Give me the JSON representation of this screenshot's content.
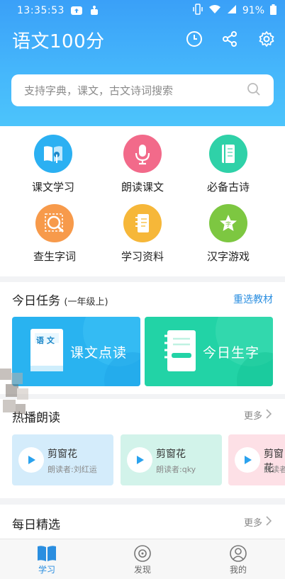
{
  "status_bar": {
    "time": "13:35:53",
    "battery": "91%"
  },
  "header": {
    "title": "语文100分",
    "icons": [
      "history-clock-icon",
      "share-icon",
      "settings-gear-icon"
    ]
  },
  "search": {
    "placeholder": "支持字典，课文，古文诗词搜索"
  },
  "grid": {
    "items": [
      {
        "label": "课文学习",
        "color": "#2bb0f2"
      },
      {
        "label": "朗读课文",
        "color": "#f26a8a"
      },
      {
        "label": "必备古诗",
        "color": "#2fd1a8"
      },
      {
        "label": "查生字词",
        "color": "#f79a4b"
      },
      {
        "label": "学习资料",
        "color": "#f6b739"
      },
      {
        "label": "汉字游戏",
        "color": "#7dc741"
      }
    ]
  },
  "today_task": {
    "title": "今日任务",
    "grade": "(一年级上)",
    "reselect": "重选教材",
    "cards": [
      {
        "label": "课文点读",
        "book_label": "语 文",
        "color": "#29b3f0"
      },
      {
        "label": "今日生字",
        "color": "#22d3a6"
      }
    ]
  },
  "hot_reading": {
    "title": "热播朗读",
    "more": "更多",
    "items": [
      {
        "title": "剪窗花",
        "reader": "朗读者:刘红运",
        "bg": "#d4ecfb"
      },
      {
        "title": "剪窗花",
        "reader": "朗读者:qky",
        "bg": "#d2f3ea"
      },
      {
        "title": "剪窗花",
        "reader": "朗读者",
        "bg": "#fde0e6"
      }
    ]
  },
  "daily_pick": {
    "title": "每日精选",
    "more": "更多"
  },
  "tabbar": {
    "tabs": [
      {
        "label": "学习",
        "active": true
      },
      {
        "label": "发现",
        "active": false
      },
      {
        "label": "我的",
        "active": false
      }
    ]
  }
}
